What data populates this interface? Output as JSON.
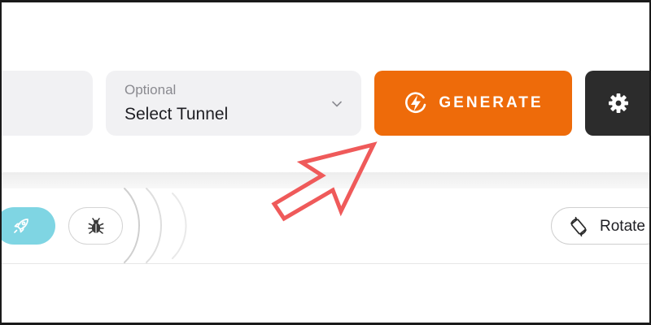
{
  "toolbar": {
    "tunnel": {
      "hint": "Optional",
      "value": "Select Tunnel",
      "icon": "chevron-down-icon"
    },
    "generate": {
      "label": "GENERATE",
      "icon": "bolt-icon",
      "color": "#ee6b0a"
    },
    "settings": {
      "icon": "gear-icon",
      "color": "#2c2c2c"
    }
  },
  "actions": {
    "rocket": {
      "icon": "rocket-icon",
      "color": "#7fd5e3"
    },
    "bug": {
      "icon": "bug-icon"
    },
    "rotate": {
      "label": "Rotate",
      "icon": "rotate-device-icon"
    }
  },
  "annotation": {
    "icon": "pointer-arrow-icon",
    "color": "#ef5a5a"
  }
}
